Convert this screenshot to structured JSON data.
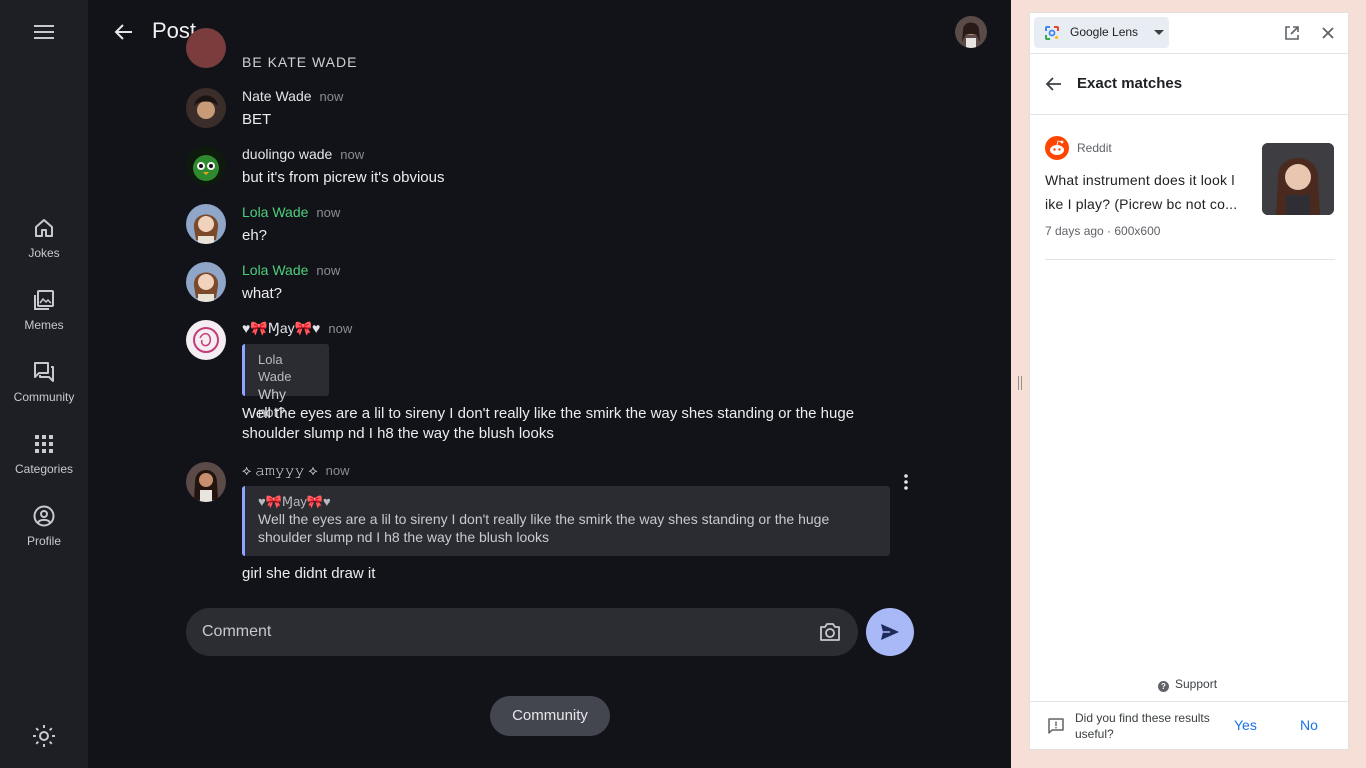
{
  "nav": {
    "items": [
      {
        "label": "Jokes",
        "icon": "home-icon"
      },
      {
        "label": "Memes",
        "icon": "image-library-icon"
      },
      {
        "label": "Community",
        "icon": "forum-icon"
      },
      {
        "label": "Categories",
        "icon": "apps-grid-icon"
      },
      {
        "label": "Profile",
        "icon": "account-circle-icon"
      }
    ]
  },
  "header": {
    "title": "Post"
  },
  "messages": {
    "cut_text": "BE KATE WADE",
    "m1": {
      "author": "Nate Wade",
      "time": "now",
      "text": "BET"
    },
    "m2": {
      "author": "duolingo wade",
      "time": "now",
      "text": "but it's from picrew it's obvious"
    },
    "m3": {
      "author": "Lola Wade",
      "time": "now",
      "text": "eh?"
    },
    "m4": {
      "author": "Lola Wade",
      "time": "now",
      "text": "what?"
    },
    "m5": {
      "author": "♥🎀Ɱay🎀♥",
      "time": "now",
      "quote_author": "Lola Wade",
      "quote_text": "Why not?",
      "text": "Well the eyes are a lil to sireny I don't really like the smirk the way shes standing or the huge shoulder slump nd I h8 the way the blush looks"
    },
    "m6": {
      "author": "⟡ 𝚊𝚖𝚢𝚢𝚢 ⟡",
      "time": "now",
      "quote_author": "♥🎀Ɱay🎀♥",
      "quote_text": "Well the eyes are a lil to sireny I don't really like the smirk the way shes standing or the huge shoulder slump nd I h8 the way the blush looks",
      "text": "girl she didnt draw it"
    }
  },
  "composer": {
    "placeholder": "Comment"
  },
  "community_chip": "Community",
  "panel": {
    "app_name": "Google Lens",
    "title": "Exact matches",
    "result": {
      "source": "Reddit",
      "title": "What instrument does it look l ike I play? (Picrew bc not co...",
      "meta": "7 days ago · 600x600"
    },
    "support": "Support",
    "feedback_question": "Did you find these results useful?",
    "yes": "Yes",
    "no": "No"
  },
  "colors": {
    "accent_green": "#4ccf7a",
    "send_button": "#a9b8f7",
    "quote_bar": "#8aa6ff",
    "link_blue": "#1a73e8",
    "reddit_orange": "#ff4500"
  }
}
